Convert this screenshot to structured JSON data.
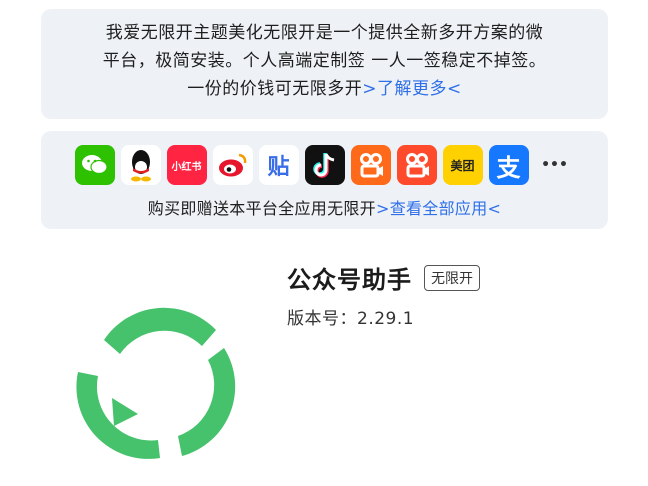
{
  "intro": {
    "line1": "我爱无限开主题美化无限开是一个提供全新多开方案的微",
    "line2": "平台，极简安装。个人高端定制签 一人一签稳定不掉签。",
    "line3_text": "一份的价钱可无限多开",
    "line3_link": ">了解更多<"
  },
  "apps_section": {
    "icons": [
      {
        "name": "wechat-icon",
        "glyph": "",
        "bg": "#2dc100"
      },
      {
        "name": "qq-icon",
        "glyph": "",
        "bg": "#ffffff"
      },
      {
        "name": "xiaohongshu-icon",
        "glyph": "小红书",
        "bg": "#ff2442"
      },
      {
        "name": "weibo-icon",
        "glyph": "",
        "bg": "#ffffff"
      },
      {
        "name": "tieba-icon",
        "glyph": "贴",
        "bg": "#ffffff"
      },
      {
        "name": "douyin-icon",
        "glyph": "",
        "bg": "#111111"
      },
      {
        "name": "kuaishou-icon",
        "glyph": "",
        "bg": "#ff6a1a"
      },
      {
        "name": "kuaishou-lite-icon",
        "glyph": "",
        "bg": "#ff4b2b"
      },
      {
        "name": "meituan-icon",
        "glyph": "美团",
        "bg": "#ffd100"
      },
      {
        "name": "alipay-icon",
        "glyph": "支",
        "bg": "#1677ff"
      },
      {
        "name": "more-icon",
        "glyph": "•••",
        "bg": "#eef2f7"
      }
    ],
    "text": "购买即赠送本平台全应用无限开",
    "link": ">查看全部应用<"
  },
  "app": {
    "name": "公众号助手",
    "badge": "无限开",
    "version": "版本号：2.29.1"
  },
  "colors": {
    "accent": "#2f6fe8",
    "logo_green": "#45c26b",
    "card_bg": "#eef2f7"
  }
}
